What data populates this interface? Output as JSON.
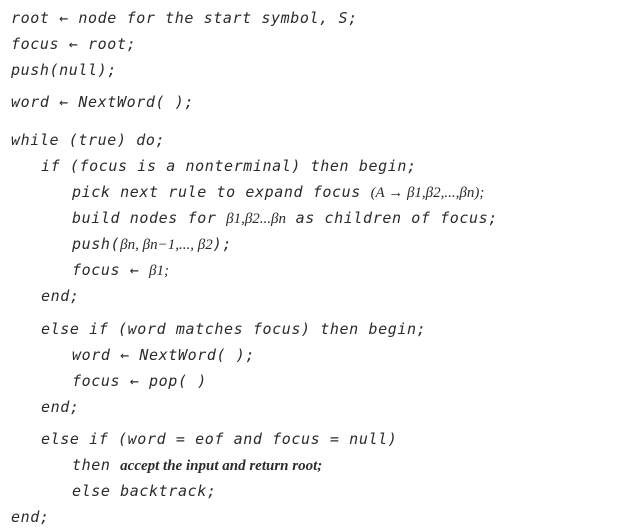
{
  "code": {
    "l01": "root ← node for the start symbol, S;",
    "l02": "focus ← root;",
    "l03": "push(null);",
    "l04": "word ← NextWord( );",
    "l05": "while (true) do;",
    "l06": "if (focus is a nonterminal) then begin;",
    "l07_pre": "pick next rule to expand focus ",
    "l07_math": "(A → β1,β2,...,βn);",
    "l08_pre": "build nodes for ",
    "l08_math": "β1,β2...βn",
    "l08_post": " as children of focus;",
    "l09_pre": "push(",
    "l09_math": "βn, βn−1,..., β2",
    "l09_post": ");",
    "l10_pre": "focus ← ",
    "l10_math": "β1;",
    "l11": "end;",
    "l12": "else if (word matches focus) then begin;",
    "l13": "word ← NextWord( );",
    "l14": "focus ← pop( )",
    "l15": "end;",
    "l16": "else if (word = eof and focus = null)",
    "l17_pre": "then ",
    "l17_text": "accept the input and return root;",
    "l18": "else backtrack;",
    "l19": "end;"
  }
}
